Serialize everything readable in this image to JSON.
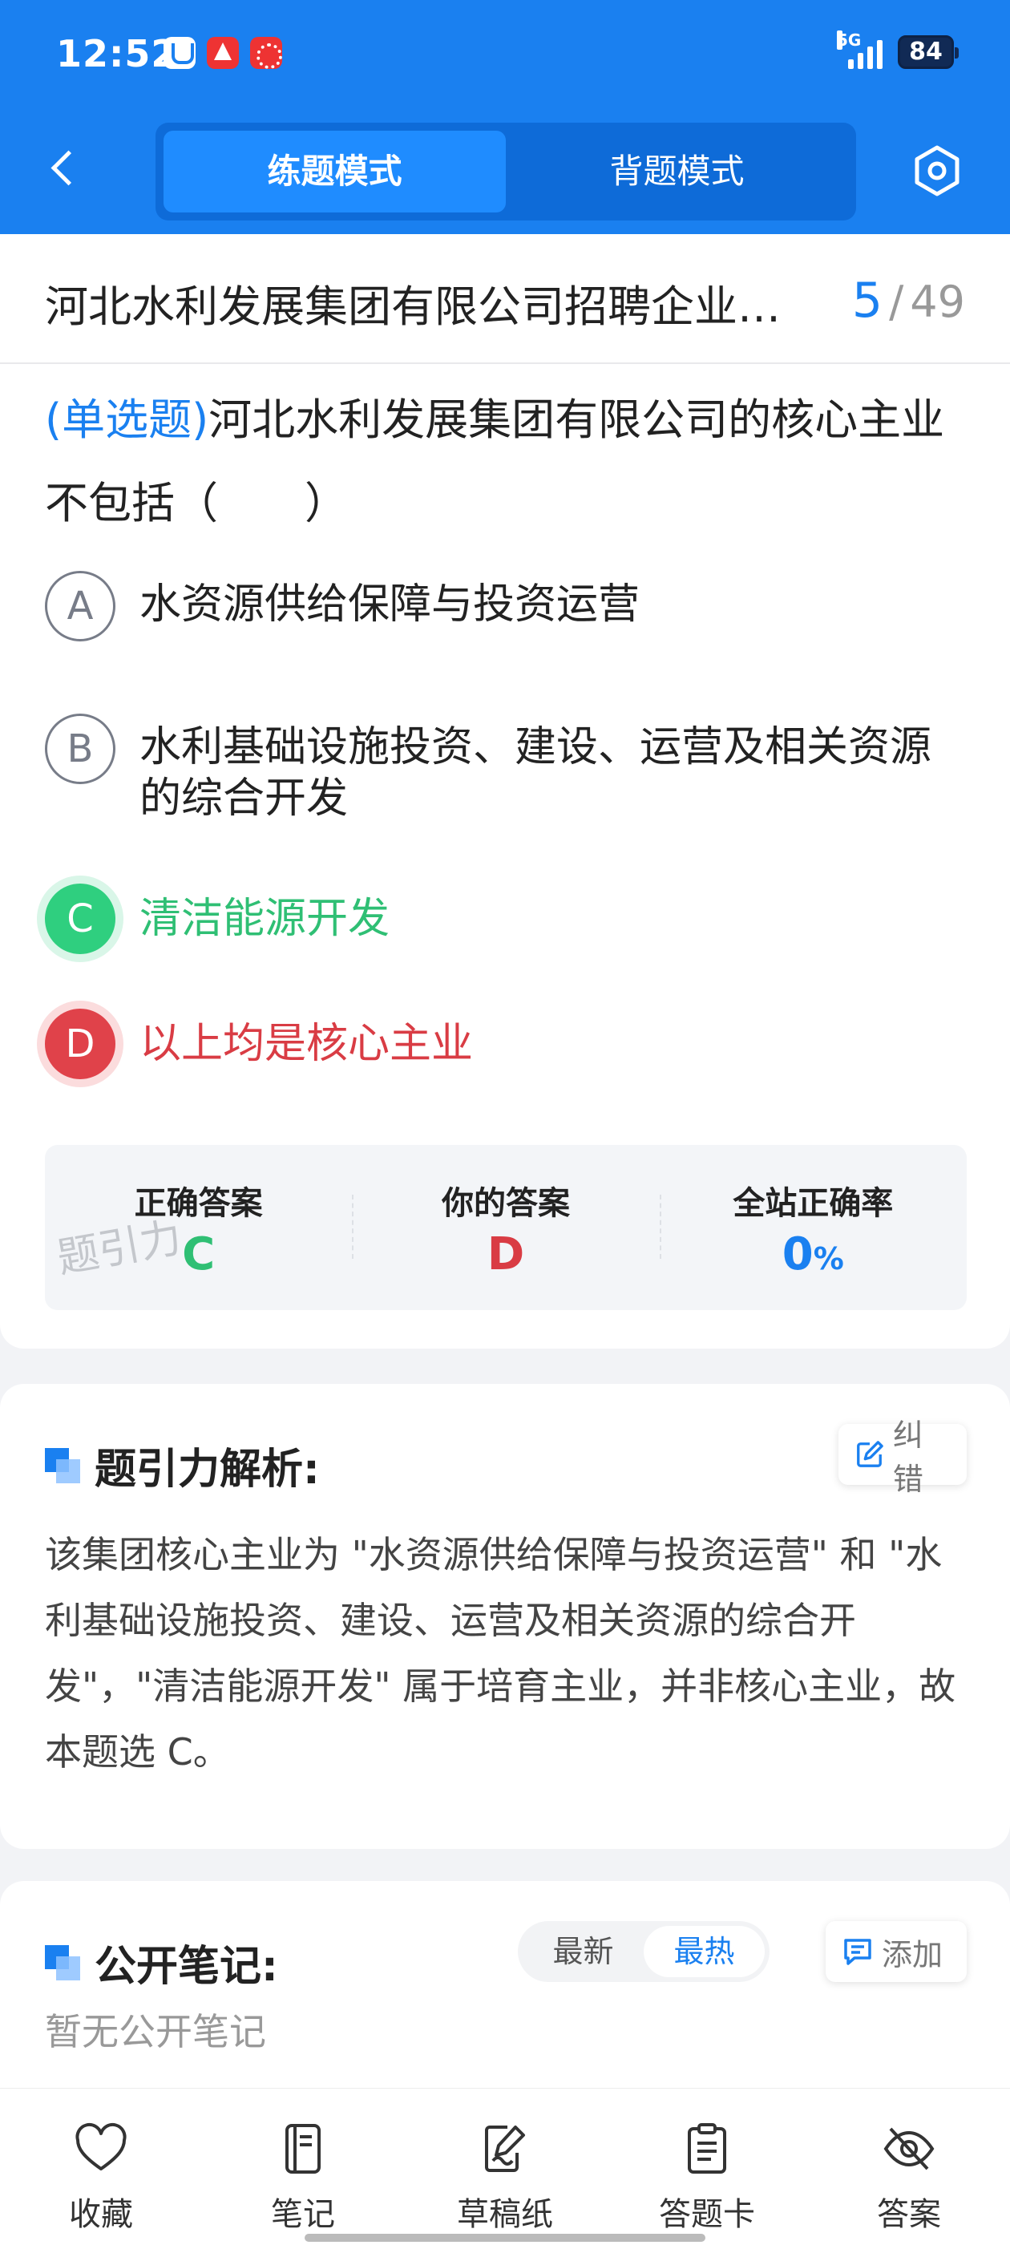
{
  "status_bar": {
    "time": "12:52",
    "network": "5G",
    "battery": "84"
  },
  "nav": {
    "tabs": [
      {
        "label": "练题模式",
        "active": true
      },
      {
        "label": "背题模式",
        "active": false
      }
    ]
  },
  "paper": {
    "title": "河北水利发展集团有限公司招聘企业…",
    "current": "5",
    "separator": "/",
    "total": "49"
  },
  "question": {
    "type": "(单选题)",
    "text": "河北水利发展集团有限公司的核心主业不包括（　　）",
    "options": [
      {
        "letter": "A",
        "text": "水资源供给保障与投资运营",
        "state": "normal"
      },
      {
        "letter": "B",
        "text": "水利基础设施投资、建设、运营及相关资源的综合开发",
        "state": "normal"
      },
      {
        "letter": "C",
        "text": "清洁能源开发",
        "state": "correct"
      },
      {
        "letter": "D",
        "text": "以上均是核心主业",
        "state": "wrong"
      }
    ]
  },
  "result": {
    "correct_label": "正确答案",
    "correct_value": "C",
    "yours_label": "你的答案",
    "yours_value": "D",
    "rate_label": "全站正确率",
    "rate_value": "0",
    "rate_unit": "%",
    "watermark": "题引力"
  },
  "analysis": {
    "title": "题引力解析:",
    "report_label": "纠错",
    "text": "该集团核心主业为 \"水资源供给保障与投资运营\" 和 \"水利基础设施投资、建设、运营及相关资源的综合开发\"，\"清洁能源开发\" 属于培育主业，并非核心主业，故本题选 C。"
  },
  "notes": {
    "title": "公开笔记:",
    "sort_newest": "最新",
    "sort_hottest": "最热",
    "add_label": "添加",
    "empty_text": "暂无公开笔记"
  },
  "bottom_bar": {
    "items": [
      {
        "label": "收藏",
        "icon": "heart-icon"
      },
      {
        "label": "笔记",
        "icon": "notebook-icon"
      },
      {
        "label": "草稿纸",
        "icon": "draft-icon"
      },
      {
        "label": "答题卡",
        "icon": "clipboard-icon"
      },
      {
        "label": "答案",
        "icon": "eye-off-icon"
      }
    ]
  },
  "colors": {
    "brand_blue": "#1a80f0",
    "correct_green": "#2fbf74",
    "wrong_red": "#d93c44"
  }
}
